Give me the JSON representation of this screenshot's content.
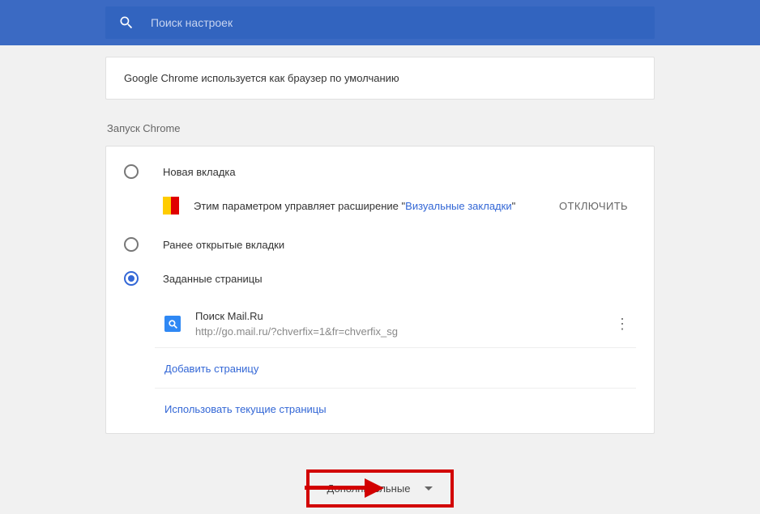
{
  "search": {
    "placeholder": "Поиск настроек"
  },
  "defaultBrowser": {
    "text": "Google Chrome используется как браузер по умолчанию"
  },
  "startup": {
    "title": "Запуск Chrome",
    "options": {
      "newTab": "Новая вкладка",
      "continue": "Ранее открытые вкладки",
      "specific": "Заданные страницы"
    },
    "extension": {
      "textBefore": "Этим параметром управляет расширение \"",
      "linkText": "Визуальные закладки",
      "textAfter": "\"",
      "disable": "ОТКЛЮЧИТЬ"
    },
    "pages": [
      {
        "name": "Поиск Mail.Ru",
        "url": "http://go.mail.ru/?chverfix=1&fr=chverfix_sg"
      }
    ],
    "addPage": "Добавить страницу",
    "useCurrent": "Использовать текущие страницы"
  },
  "advanced": {
    "label": "Дополнительные"
  }
}
